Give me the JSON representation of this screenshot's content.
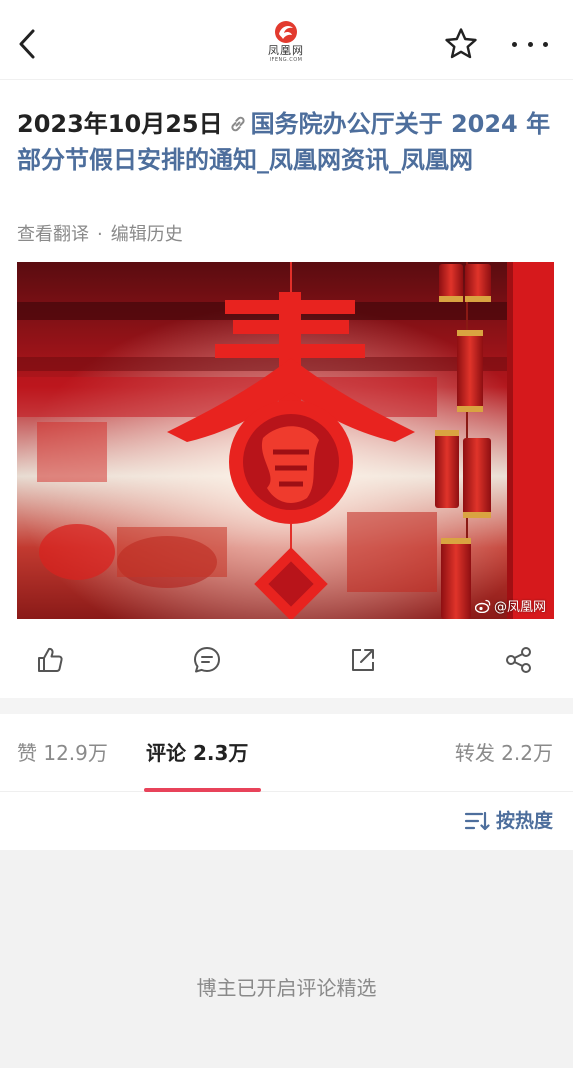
{
  "logo": {
    "cn": "凤凰网",
    "en": "IFENG.COM"
  },
  "post": {
    "date": "2023年10月25日",
    "link_title": "国务院办公厅关于 2024 年部分节假日安排的通知_凤凰网资讯_凤凰网",
    "view_translation": "查看翻译",
    "separator": "·",
    "edit_history": "编辑历史"
  },
  "image": {
    "watermark": "@凤凰网"
  },
  "tabs": {
    "likes": "赞 12.9万",
    "comments": "评论 2.3万",
    "reposts": "转发 2.2万"
  },
  "sort": {
    "label": "按热度"
  },
  "comments": {
    "curated_notice": "博主已开启评论精选"
  },
  "colors": {
    "accent": "#e8435a",
    "link": "#4d6e9c"
  }
}
